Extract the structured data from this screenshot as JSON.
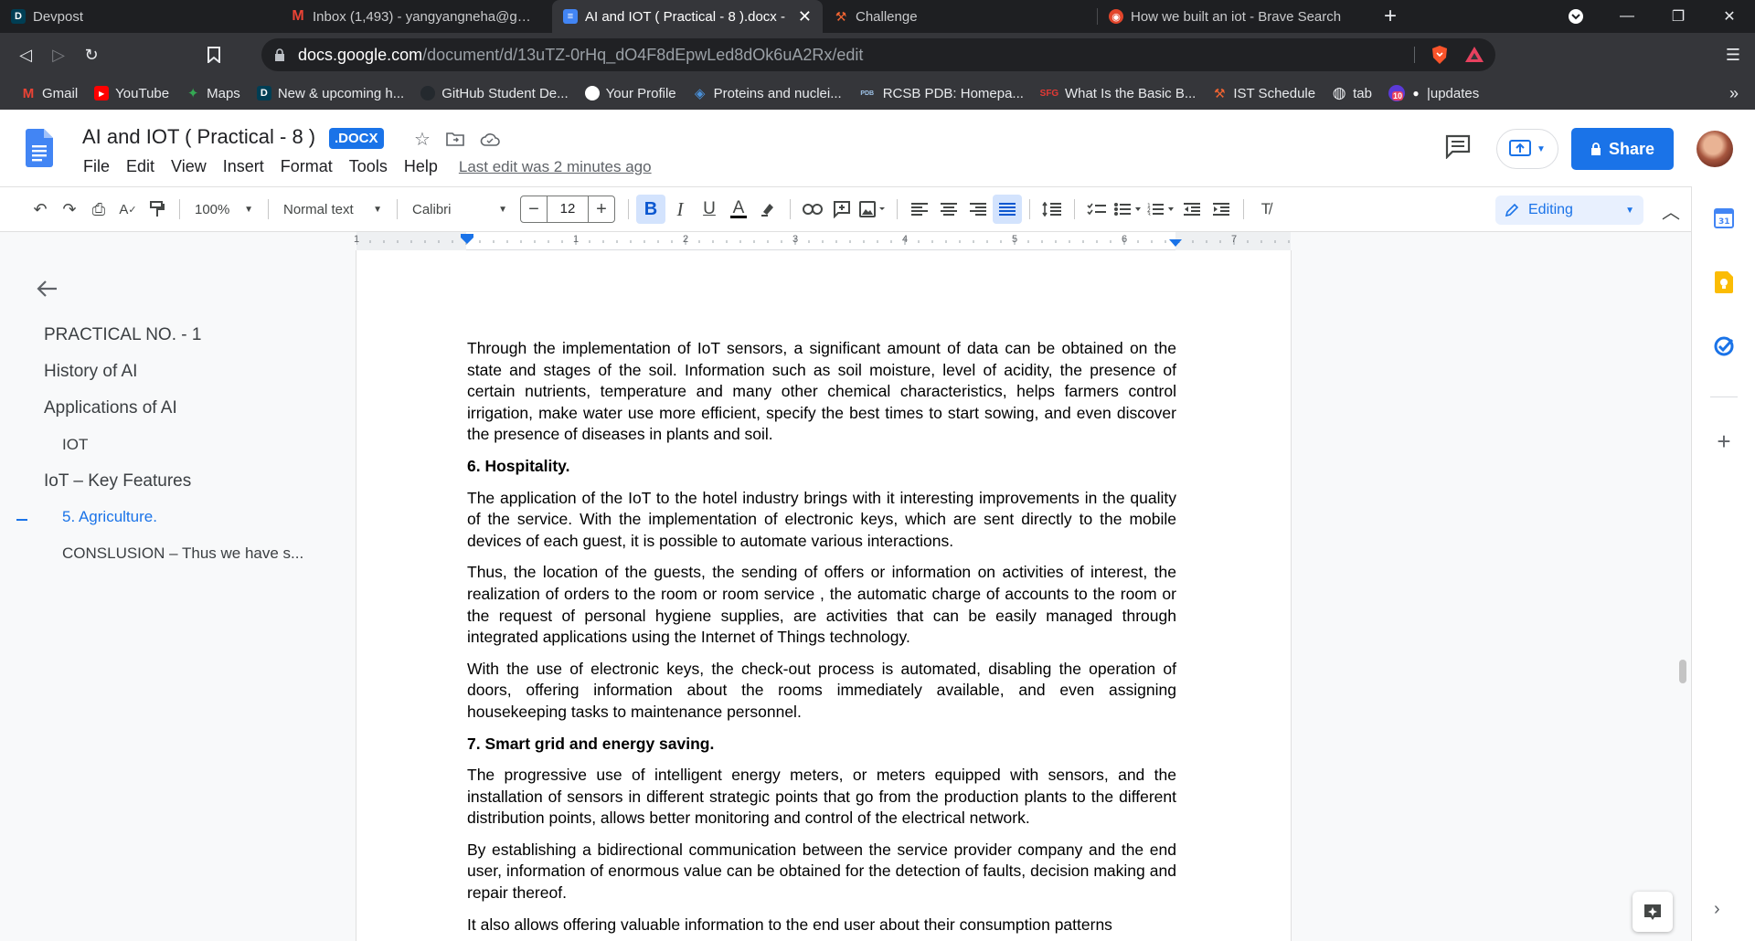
{
  "browser": {
    "tabs": [
      {
        "title": "Devpost",
        "icon": "devpost-icon",
        "icon_letter": "D",
        "icon_color": "#003e54",
        "active": false
      },
      {
        "title": "Inbox (1,493) - yangyangneha@gmail.",
        "icon": "gmail-icon",
        "icon_letter": "M",
        "icon_color": "#ea4335",
        "active": false
      },
      {
        "title": "AI and IOT ( Practical - 8 ).docx -",
        "icon": "google-docs-icon",
        "icon_letter": "≡",
        "icon_color": "#4285f4",
        "active": true
      },
      {
        "title": "Challenge",
        "icon": "challenge-icon",
        "icon_letter": "⚒",
        "icon_color": "#f06432",
        "active": false
      },
      {
        "title": "How we built an iot - Brave Search",
        "icon": "brave-search-icon",
        "icon_letter": "◉",
        "icon_color": "#e2452b",
        "active": false
      }
    ],
    "url_host": "docs.google.com",
    "url_path": "/document/d/13uTZ-0rHq_dO4F8dEpwLed8dOk6uA2Rx/edit",
    "bookmarks": [
      {
        "label": "Gmail",
        "icon": "gmail-icon",
        "glyph": "M",
        "color": "#ea4335"
      },
      {
        "label": "YouTube",
        "icon": "youtube-icon",
        "glyph": "▶",
        "color": "#ff0000"
      },
      {
        "label": "Maps",
        "icon": "maps-icon",
        "glyph": "✦",
        "color": "#34a853"
      },
      {
        "label": "New & upcoming h...",
        "icon": "devpost-icon",
        "glyph": "D",
        "color": "#003e54"
      },
      {
        "label": "GitHub Student De...",
        "icon": "github-icon",
        "glyph": "●",
        "color": "#24292e"
      },
      {
        "label": "Your Profile",
        "icon": "github-icon",
        "glyph": "●",
        "color": "#24292e"
      },
      {
        "label": "Proteins and nuclei...",
        "icon": "protein-icon",
        "glyph": "◈",
        "color": "#4a90d9"
      },
      {
        "label": "RCSB PDB: Homepa...",
        "icon": "pdb-icon",
        "glyph": "PDB",
        "color": "#1c4e80"
      },
      {
        "label": "What Is the Basic B...",
        "icon": "sfg-icon",
        "glyph": "SFG",
        "color": "#e53935"
      },
      {
        "label": "IST Schedule",
        "icon": "challenge-icon",
        "glyph": "⚒",
        "color": "#f06432"
      },
      {
        "label": "tab",
        "icon": "globe-icon",
        "glyph": "◍",
        "color": "#9aa0a6"
      },
      {
        "label": "|updates",
        "icon": "updates-icon",
        "glyph": "●",
        "color": "#ffffff"
      }
    ],
    "bookmark_badge": "10"
  },
  "docs": {
    "title": "AI and IOT ( Practical - 8 )",
    "badge": ".DOCX",
    "menu": [
      "File",
      "Edit",
      "View",
      "Insert",
      "Format",
      "Tools",
      "Help"
    ],
    "last_edit": "Last edit was 2 minutes ago",
    "share_label": "Share",
    "accent": "#1a73e8"
  },
  "toolbar": {
    "zoom": "100%",
    "style": "Normal text",
    "font": "Calibri",
    "font_size": "12",
    "mode": "Editing"
  },
  "ruler": [
    "1",
    "1",
    "2",
    "3",
    "4",
    "5",
    "6",
    "7"
  ],
  "outline": [
    {
      "label": "PRACTICAL NO. - 1",
      "level": 1,
      "current": false
    },
    {
      "label": "History of AI",
      "level": 1,
      "current": false
    },
    {
      "label": "Applications of AI",
      "level": 1,
      "current": false
    },
    {
      "label": "IOT",
      "level": 2,
      "current": false
    },
    {
      "label": "IoT – Key Features",
      "level": 1,
      "current": false
    },
    {
      "label": "5. Agriculture.",
      "level": 2,
      "current": true
    },
    {
      "label": "CONSLUSION – Thus we have s...",
      "level": 2,
      "current": false
    }
  ],
  "document": {
    "paragraphs": [
      {
        "heading": false,
        "text": "Through the implementation of IoT sensors, a significant amount of data can be obtained on the state and stages of the soil. Information such as soil moisture, level of acidity, the presence of certain nutrients, temperature and many other chemical characteristics, helps farmers control irrigation, make water use more efficient, specify the best times to start sowing, and even discover the presence of diseases in plants and soil."
      },
      {
        "heading": true,
        "text": "6. Hospitality."
      },
      {
        "heading": false,
        "text": "The application of the IoT to the hotel industry brings with it interesting improvements in the quality of the service. With the implementation of electronic keys, which are sent directly to the mobile devices of each guest, it is possible to automate various interactions."
      },
      {
        "heading": false,
        "text": "Thus, the location of the guests, the sending of offers or information on activities of interest, the realization of orders to the room or room service , the automatic charge of accounts to the room or the request of personal hygiene supplies, are activities that can be easily managed through integrated applications using the Internet of Things technology."
      },
      {
        "heading": false,
        "text": "With the use of electronic keys, the check-out process is automated, disabling the operation of doors, offering information about the rooms immediately available, and even assigning housekeeping tasks to maintenance personnel."
      },
      {
        "heading": true,
        "text": "7. Smart grid and energy saving."
      },
      {
        "heading": false,
        "text": "The progressive use of intelligent energy meters, or meters equipped with sensors, and the installation of sensors in different strategic points that go from the production plants to the different distribution points, allows better monitoring and control of the electrical network."
      },
      {
        "heading": false,
        "text": "By establishing a bidirectional communication between the service provider company and the end user, information of enormous value can be obtained for the detection of faults, decision making and repair thereof."
      },
      {
        "heading": false,
        "text": "It also allows offering valuable information to the end user about their consumption patterns"
      }
    ]
  }
}
